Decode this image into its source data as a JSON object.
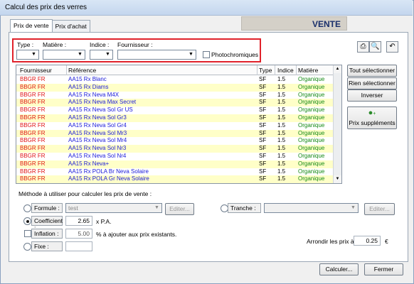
{
  "window": {
    "title": "Calcul des prix des verres"
  },
  "tabs": [
    {
      "label": "Prix de vente",
      "active": true
    },
    {
      "label": "Prix d'achat",
      "active": false
    }
  ],
  "mode_banner": "VENTE",
  "filters": {
    "type_label": "Type :",
    "matiere_label": "Matière :",
    "indice_label": "Indice :",
    "fournisseur_label": "Fournisseur :",
    "type_value": "",
    "matiere_value": "",
    "indice_value": "",
    "fournisseur_value": "",
    "photochromiques_label": "Photochromiques",
    "photochromiques_checked": false
  },
  "toolbar": {
    "icons": [
      "printer-icon",
      "print-preview-icon",
      "undo-icon"
    ]
  },
  "table": {
    "columns": [
      "Fournisseur",
      "Référence",
      "Type",
      "Indice",
      "Matière"
    ],
    "rows": [
      {
        "fournisseur": "BBGR FR",
        "reference": "AA15 Rx Blanc",
        "type": "SF",
        "indice": "1.5",
        "matiere": "Organique"
      },
      {
        "fournisseur": "BBGR FR",
        "reference": "AA15 Rx Diams",
        "type": "SF",
        "indice": "1.5",
        "matiere": "Organique"
      },
      {
        "fournisseur": "BBGR FR",
        "reference": "AA15 Rx Neva M4X",
        "type": "SF",
        "indice": "1.5",
        "matiere": "Organique"
      },
      {
        "fournisseur": "BBGR FR",
        "reference": "AA15 Rx Neva Max Secret",
        "type": "SF",
        "indice": "1.5",
        "matiere": "Organique"
      },
      {
        "fournisseur": "BBGR FR",
        "reference": "AA15 Rx Neva Sol Gr US",
        "type": "SF",
        "indice": "1.5",
        "matiere": "Organique"
      },
      {
        "fournisseur": "BBGR FR",
        "reference": "AA15 Rx Neva Sol Gr3",
        "type": "SF",
        "indice": "1.5",
        "matiere": "Organique"
      },
      {
        "fournisseur": "BBGR FR",
        "reference": "AA15 Rx Neva Sol Gr4",
        "type": "SF",
        "indice": "1.5",
        "matiere": "Organique"
      },
      {
        "fournisseur": "BBGR FR",
        "reference": "AA15 Rx Neva Sol Mr3",
        "type": "SF",
        "indice": "1.5",
        "matiere": "Organique"
      },
      {
        "fournisseur": "BBGR FR",
        "reference": "AA15 Rx Neva Sol Mr4",
        "type": "SF",
        "indice": "1.5",
        "matiere": "Organique"
      },
      {
        "fournisseur": "BBGR FR",
        "reference": "AA15 Rx Neva Sol Nr3",
        "type": "SF",
        "indice": "1.5",
        "matiere": "Organique"
      },
      {
        "fournisseur": "BBGR FR",
        "reference": "AA15 Rx Neva Sol Nr4",
        "type": "SF",
        "indice": "1.5",
        "matiere": "Organique"
      },
      {
        "fournisseur": "BBGR FR",
        "reference": "AA15 Rx Neva+",
        "type": "SF",
        "indice": "1.5",
        "matiere": "Organique"
      },
      {
        "fournisseur": "BBGR FR",
        "reference": "AA15 Rx POLA Br Neva Solaire",
        "type": "SF",
        "indice": "1.5",
        "matiere": "Organique"
      },
      {
        "fournisseur": "BBGR FR",
        "reference": "AA15 Rx POLA Gr Neva Solaire",
        "type": "SF",
        "indice": "1.5",
        "matiere": "Organique"
      }
    ]
  },
  "side_buttons": {
    "select_all": "Tout sélectionner",
    "select_none": "Rien sélectionner",
    "invert": "Inverser",
    "supplements": "Prix suppléments"
  },
  "method": {
    "heading": "Méthode à utiliser pour calculer les prix de vente :",
    "formule_label": "Formule :",
    "formule_value": "test",
    "formule_edit": "Editer...",
    "tranche_label": "Tranche :",
    "tranche_value": "",
    "tranche_edit": "Editer...",
    "coefficient_label": "Coefficient :",
    "coefficient_value": "2.65",
    "coefficient_suffix": "x P.A.",
    "inflation_label": "Inflation :",
    "inflation_value": "5.00",
    "inflation_suffix": "% à ajouter aux prix existants.",
    "fixe_label": "Fixe :",
    "fixe_value": "",
    "selected": "coefficient"
  },
  "rounding": {
    "label": "Arrondir les prix à",
    "value": "0.25",
    "unit": "€"
  },
  "footer": {
    "calculate": "Calculer...",
    "close": "Fermer"
  },
  "colors": {
    "row_alt": "#ffffc8",
    "supplier": "#e01414",
    "reference": "#1a1ad8",
    "matiere": "#168a16",
    "highlight_box": "#e0222b",
    "banner": "#1a2f6b"
  }
}
